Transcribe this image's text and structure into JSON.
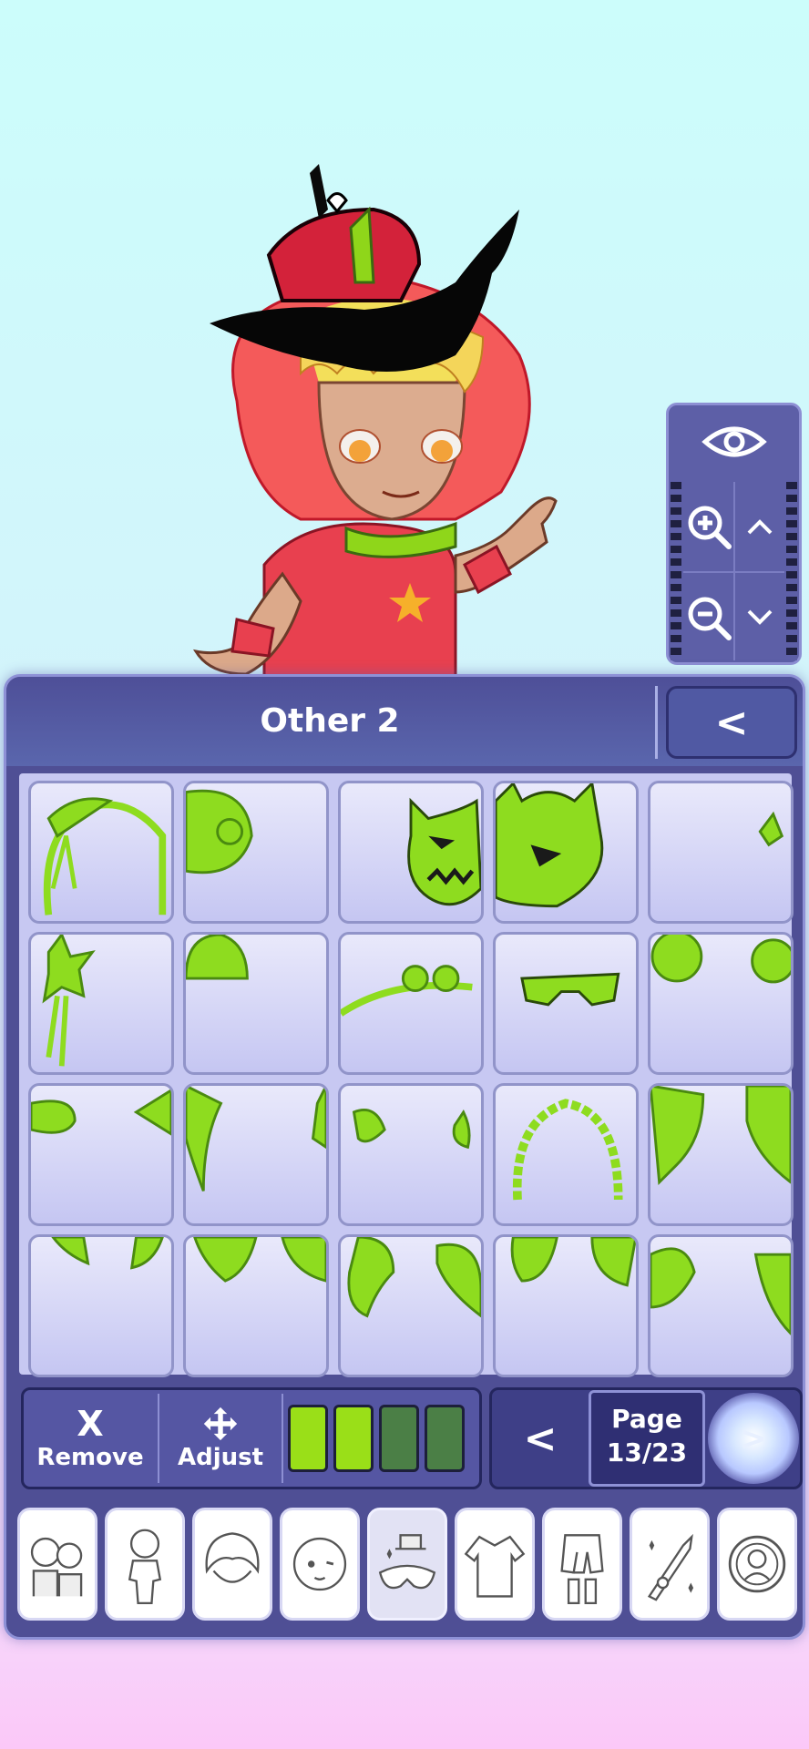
{
  "panel": {
    "title": "Other 2",
    "back_label": "<"
  },
  "controls": {
    "remove_label": "Remove",
    "remove_symbol": "X",
    "adjust_label": "Adjust",
    "swatch_colors": [
      "#9adf18",
      "#9adf18",
      "#4b7f46",
      "#4b7f46"
    ]
  },
  "pagination": {
    "prev_label": "<",
    "page_word": "Page",
    "page_value": "13/23",
    "next_label": ">"
  },
  "items": [
    "headband-bows",
    "ball-mask",
    "demon-mask",
    "fox-mask",
    "small-sprout",
    "star-hairpiece",
    "knit-cap",
    "goggles-headband",
    "visor-glasses",
    "puff-clips",
    "horn-left-curl",
    "wing-fins",
    "small-wings",
    "bead-headband",
    "leaf-bunches",
    "leaf-tufts",
    "leaf-clusters",
    "long-horns",
    "fluffy-tufts",
    "leaf-pair"
  ],
  "tabs": [
    {
      "icon": "presets-icon",
      "active": false
    },
    {
      "icon": "body-icon",
      "active": false
    },
    {
      "icon": "hair-icon",
      "active": false
    },
    {
      "icon": "face-icon",
      "active": false
    },
    {
      "icon": "accessories-icon",
      "active": true
    },
    {
      "icon": "top-icon",
      "active": false
    },
    {
      "icon": "bottom-icon",
      "active": false
    },
    {
      "icon": "weapon-icon",
      "active": false
    },
    {
      "icon": "profile-icon",
      "active": false
    }
  ]
}
